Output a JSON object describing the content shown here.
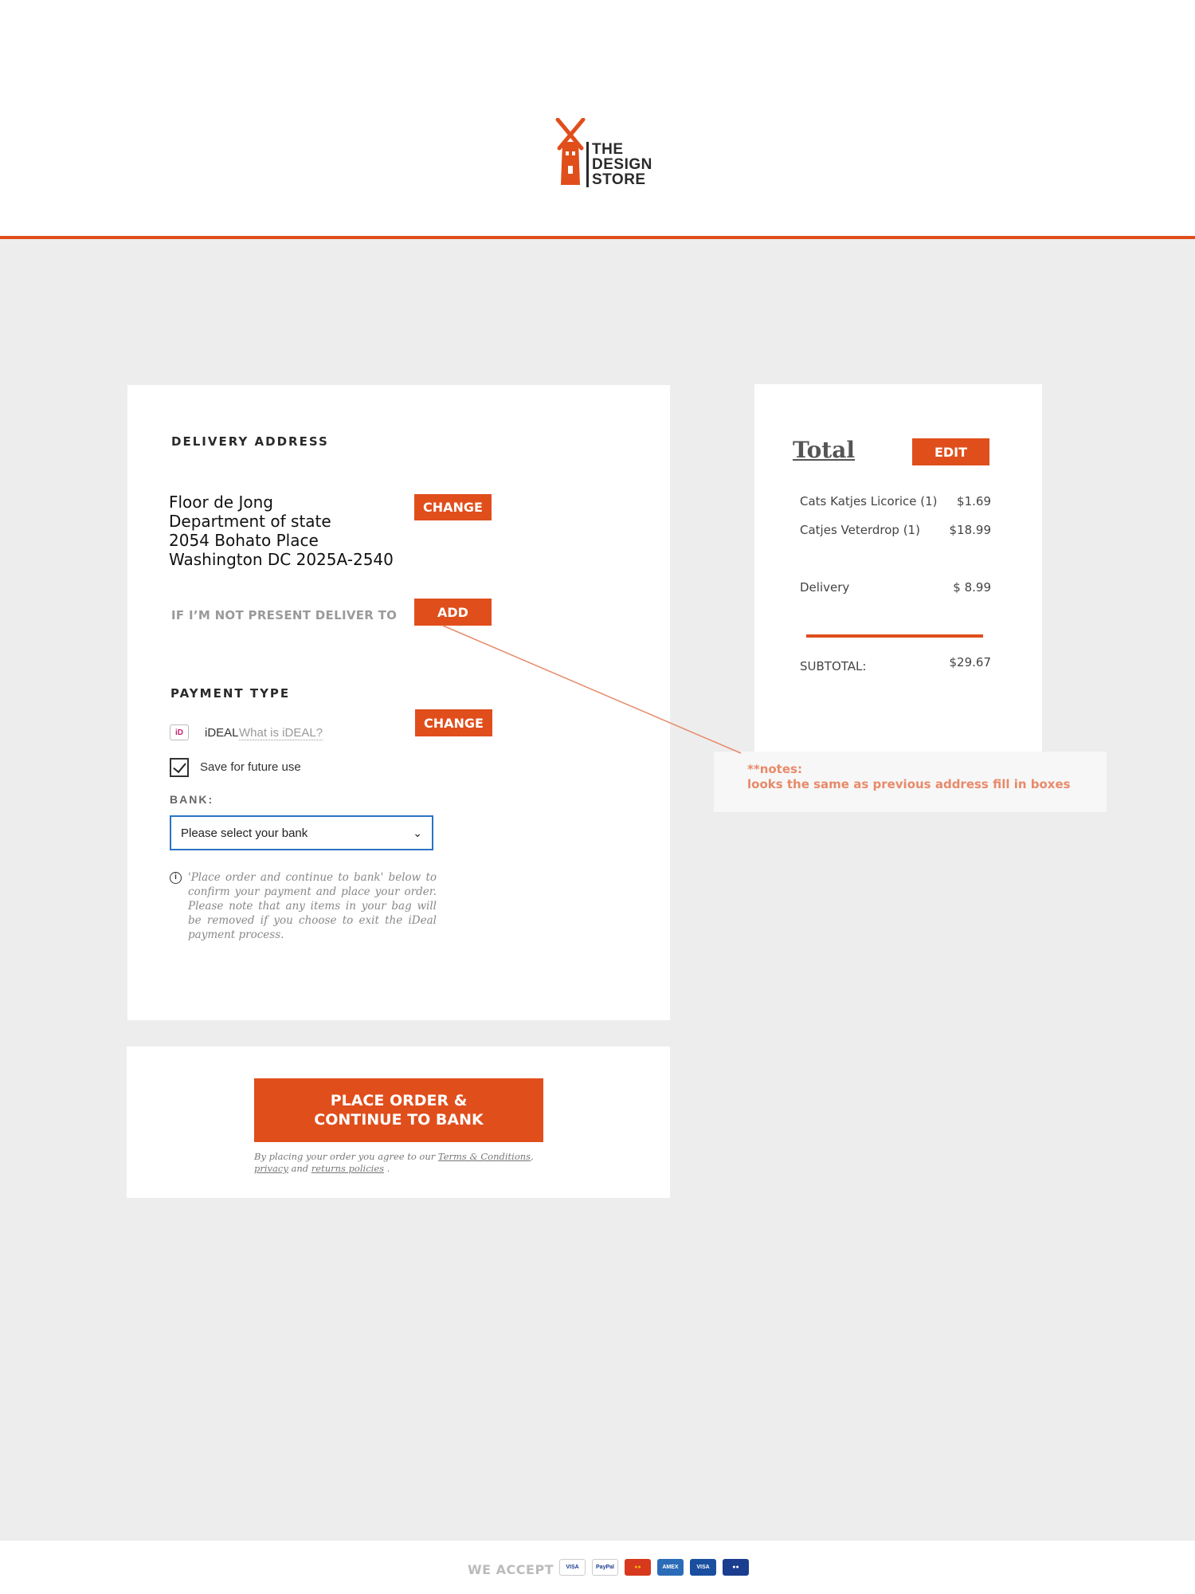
{
  "brand": {
    "line1": "THE",
    "line2": "DESIGN",
    "line3": "STORE",
    "accent": "#e04e1c"
  },
  "delivery": {
    "title": "DELIVERY ADDRESS",
    "name": "Floor de Jong",
    "line2": "Department of state",
    "line3": "2054 Bohato Place",
    "line4": "Washington DC 2025A-2540",
    "change_label": "CHANGE",
    "alt_label": "IF I’M NOT PRESENT DELIVER TO",
    "add_label": "ADD"
  },
  "payment": {
    "title": "PAYMENT TYPE",
    "method": "iDEAL",
    "method_link": "What is iDEAL?",
    "change_label": "CHANGE",
    "save_label": "Save for future use",
    "save_checked": true,
    "bank_label": "BANK:",
    "bank_placeholder": "Please select your bank",
    "info": "'Place order and continue to bank' below to confirm your payment and place your order. Please note that any items in your bag will be removed if you choose to exit the iDeal payment process."
  },
  "total": {
    "title": "Total",
    "edit_label": "EDIT",
    "items": [
      {
        "name": "Cats Katjes Licorice (1)",
        "price": "$1.69"
      },
      {
        "name": "Catjes Veterdrop (1)",
        "price": "$18.99"
      }
    ],
    "delivery_label": "Delivery",
    "delivery_price": "$ 8.99",
    "subtotal_label": "SUBTOTAL:",
    "subtotal_price": "$29.67"
  },
  "notes": {
    "line1": "**notes:",
    "line2": "looks the same as previous address fill in boxes"
  },
  "order": {
    "button_line1": "PLACE ORDER &",
    "button_line2": "CONTINUE TO BANK",
    "terms_prefix": "By placing your order you agree to our",
    "terms_link": "Terms & Conditions",
    "privacy_link": "privacy",
    "terms_and": "and",
    "returns_link": "returns policies",
    "terms_suffix": "."
  },
  "footer": {
    "we_accept": "WE ACCEPT",
    "cards": [
      "VISA",
      "PayPal",
      "MasterCard",
      "American Express",
      "VISA Electron",
      "Maestro"
    ]
  }
}
